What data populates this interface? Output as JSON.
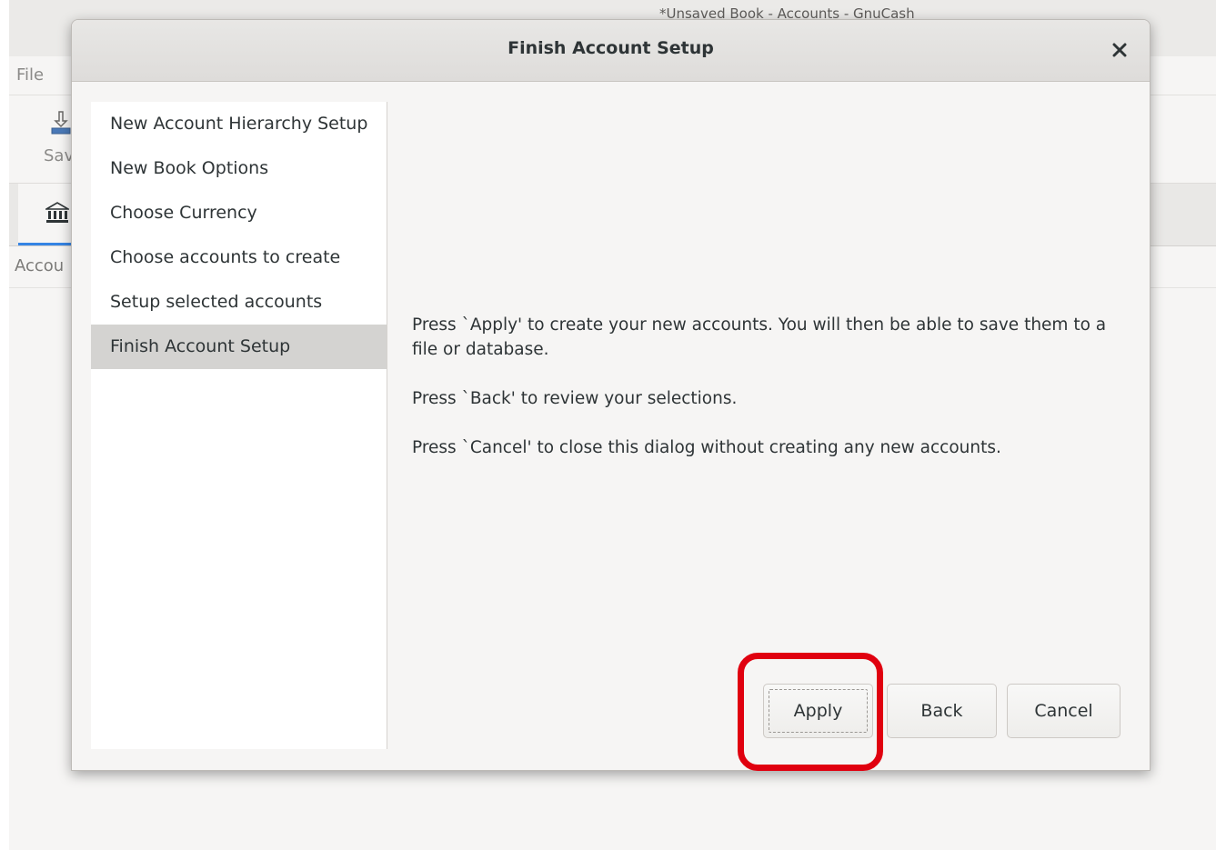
{
  "background_window": {
    "title": "*Unsaved Book - Accounts - GnuCash",
    "menu_file": "File",
    "toolbar_save": "Sav",
    "accounts_tab_label": "Accou"
  },
  "dialog": {
    "title": "Finish Account Setup",
    "close_label": "×",
    "sidebar": {
      "items": [
        {
          "label": "New Account Hierarchy Setup"
        },
        {
          "label": "New Book Options"
        },
        {
          "label": "Choose Currency"
        },
        {
          "label": "Choose accounts to create"
        },
        {
          "label": "Setup selected accounts"
        },
        {
          "label": "Finish Account Setup"
        }
      ],
      "selected_index": 5
    },
    "content": {
      "paragraph_apply": "Press `Apply' to create your new accounts. You will then be able to save them to a file or database.",
      "paragraph_back": "Press `Back' to review your selections.",
      "paragraph_cancel": "Press `Cancel' to close this dialog without creating any new accounts."
    },
    "buttons": {
      "apply": "Apply",
      "back": "Back",
      "cancel": "Cancel"
    }
  },
  "annotation": {
    "highlight_color": "#e0000f",
    "highlight_target": "apply-button"
  },
  "colors": {
    "selected_item_bg": "#d4d3d1",
    "accent_tab": "#3584e4"
  }
}
